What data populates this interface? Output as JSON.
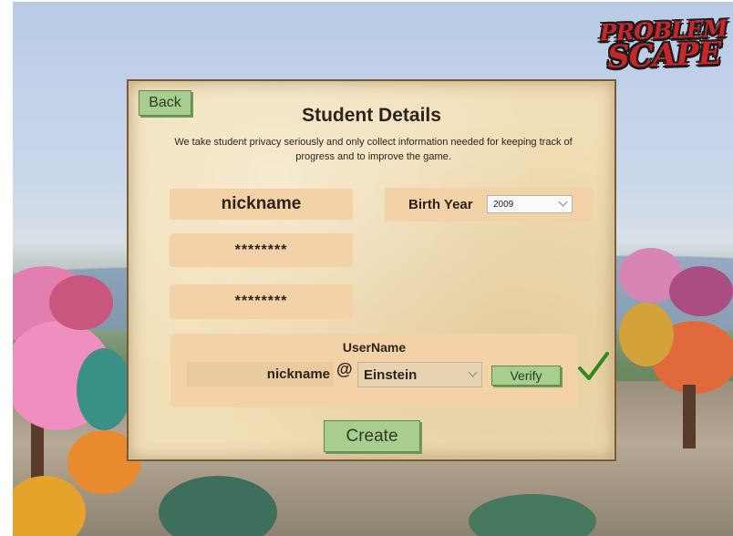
{
  "logo": {
    "line1": "PROBLEM",
    "line2": "SCAPE"
  },
  "back_label": "Back",
  "title": "Student Details",
  "privacy_text": "We take student privacy seriously and only collect information needed for keeping track of progress and to improve the game.",
  "nickname_value": "nickname",
  "password_value": "********",
  "confirm_password_value": "********",
  "birth_year": {
    "label": "Birth Year",
    "selected": "2009"
  },
  "username": {
    "title": "UserName",
    "nickname_part": "nickname",
    "separator": "@",
    "name_selected": "Einstein",
    "verify_label": "Verify",
    "verified": true
  },
  "create_label": "Create",
  "colors": {
    "button_green": "#a7cd8f",
    "field_tan": "#f3d2a8",
    "panel_parchment": "#f1dfb7",
    "check_green": "#2f8a1e",
    "logo_red": "#c6272a"
  }
}
